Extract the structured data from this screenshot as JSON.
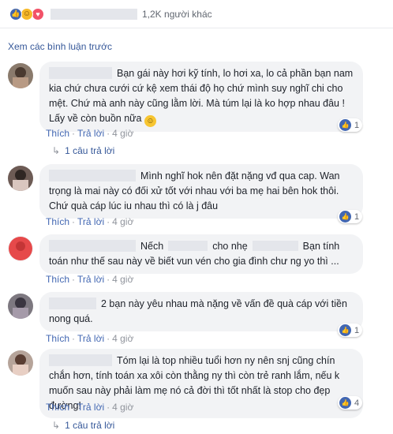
{
  "reactions_bar": {
    "count_text": "1,2K người khác",
    "icons": [
      "like-icon",
      "haha-icon",
      "love-icon"
    ]
  },
  "prev_comments_link": "Xem các bình luận trước",
  "actions": {
    "like": "Thích",
    "reply": "Trả lời"
  },
  "comments": [
    {
      "text": "Bạn gái này hơi kỹ tính, lo hơi xa, lo cả phần bạn nam kia chứ chưa cưới cứ kệ xem thái độ họ chứ mình suy nghĩ chi cho mệt. Chứ mà anh này cũng lằm lời. Mà túm lại là ko hợp nhau đâu ! Lấy về còn buồn nữa",
      "emoji": "smiley-emoji",
      "time": "4 giờ",
      "likes": "1",
      "replies": "1 câu trả lời"
    },
    {
      "text": "Mình nghĩ hok nên đặt nặng vđ qua cap. Wan trọng là mai này có đối xử tốt với nhau với ba mẹ hai bên hok thôi. Chứ quà cáp lúc iu nhau thì có là j đâu",
      "time": "4 giờ",
      "likes": "1"
    },
    {
      "text_a": "Nếch",
      "text_b": "cho nhẹ",
      "text_c": "Bạn tính toán như thế sau này về biết vun vén cho gia đình chư ng yo thì ...",
      "time": "4 giờ"
    },
    {
      "text": "2 bạn này yêu nhau mà nặng về vấn đề quà cáp với tiền nong quá.",
      "time": "4 giờ",
      "likes": "1"
    },
    {
      "text": "Tóm lại là top nhiều tuổi hơn ny nên snj cũng chín chắn hơn, tính toán xa xôi còn thằng ny thì còn trẻ ranh lắm, nếu k muốn sau này phải làm mẹ nó cả đời thì tốt nhất là stop cho đẹp đường!",
      "time": "4 giờ",
      "likes": "4",
      "replies": "1 câu trả lời"
    }
  ],
  "colors": {
    "link": "#365899",
    "action": "#4267b2",
    "bubble": "#f2f3f5",
    "meta": "#90949c"
  }
}
